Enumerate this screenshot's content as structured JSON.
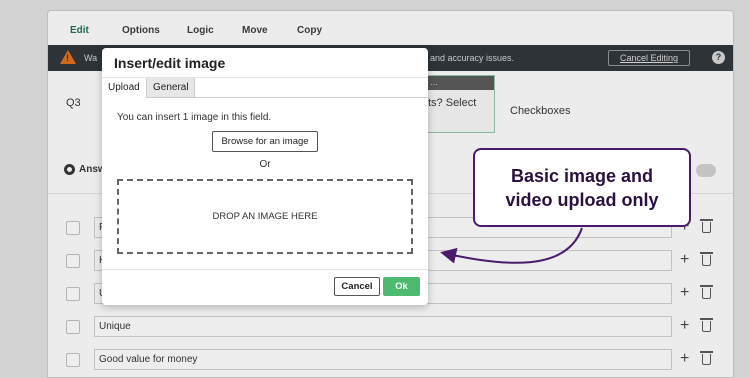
{
  "tabs": [
    "Edit",
    "Options",
    "Logic",
    "Move",
    "Copy"
  ],
  "banner": {
    "text_left": "Wa",
    "text_right": "and accuracy issues.",
    "cancel_label": "Cancel Editing",
    "help": "?",
    "warn": "!"
  },
  "question": {
    "number": "Q3",
    "visible_text": "ts? Select",
    "type": "Checkboxes",
    "toolbar": "…"
  },
  "answers_label": "Answ",
  "rows": [
    {
      "value": "F"
    },
    {
      "value": "H"
    },
    {
      "value": "U"
    },
    {
      "value": "Unique"
    },
    {
      "value": "Good value for money"
    }
  ],
  "row_plus": "+",
  "dialog": {
    "title": "Insert/edit image",
    "tab_upload": "Upload",
    "tab_general": "General",
    "hint": "You can insert 1 image in this field.",
    "browse": "Browse for an image",
    "or": "Or",
    "dropzone": "DROP AN IMAGE HERE",
    "cancel": "Cancel",
    "ok": "Ok"
  },
  "callout": {
    "line1": "Basic image and",
    "line2": "video upload only",
    "border_color": "#4b1b6b"
  },
  "colors": {
    "accent": "#2e8b6a",
    "ok_button": "#4cba6f",
    "banner": "#2e3338",
    "warning": "#d16a1e"
  }
}
